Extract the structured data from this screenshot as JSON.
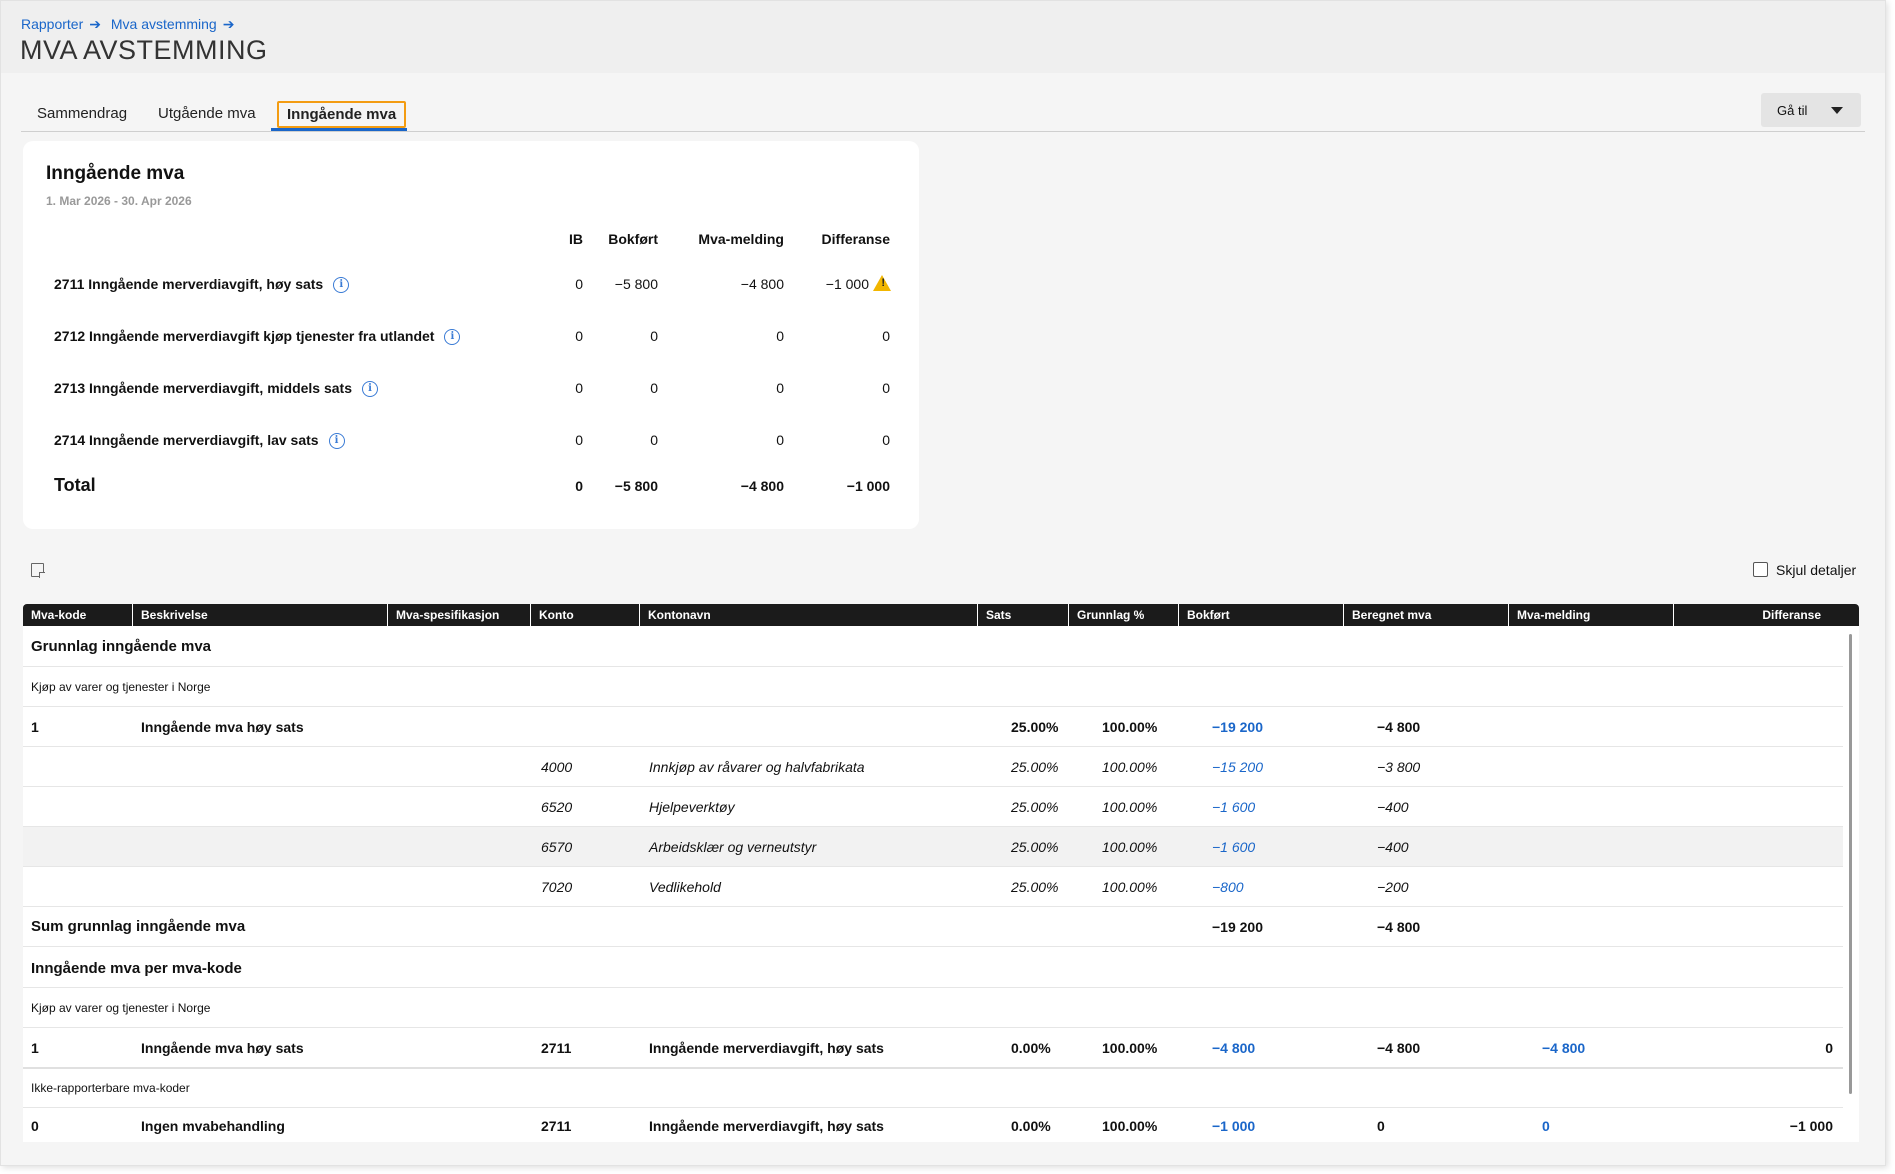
{
  "breadcrumb": [
    "Rapporter",
    "Mva avstemming"
  ],
  "page_title": "MVA AVSTEMMING",
  "tabs": [
    "Sammendrag",
    "Utgående mva",
    "Inngående mva"
  ],
  "active_tab": "Inngående mva",
  "goto_label": "Gå til",
  "summary": {
    "title": "Inngående mva",
    "period": "1. Mar 2026 - 30. Apr 2026",
    "headers": [
      "IB",
      "Bokført",
      "Mva-melding",
      "Differanse"
    ],
    "rows": [
      {
        "label": "2711 Inngående merverdiavgift, høy sats",
        "ib": "0",
        "bokfort": "−5 800",
        "mva_melding": "−4 800",
        "differanse": "−1 000",
        "warning": true
      },
      {
        "label": "2712 Inngående merverdiavgift kjøp tjenester fra utlandet",
        "ib": "0",
        "bokfort": "0",
        "mva_melding": "0",
        "differanse": "0"
      },
      {
        "label": "2713 Inngående merverdiavgift, middels sats",
        "ib": "0",
        "bokfort": "0",
        "mva_melding": "0",
        "differanse": "0"
      },
      {
        "label": "2714 Inngående merverdiavgift, lav sats",
        "ib": "0",
        "bokfort": "0",
        "mva_melding": "0",
        "differanse": "0"
      }
    ],
    "total": {
      "label": "Total",
      "ib": "0",
      "bokfort": "−5 800",
      "mva_melding": "−4 800",
      "differanse": "−1 000"
    }
  },
  "hide_details_label": "Skjul detaljer",
  "grid": {
    "headers": [
      "Mva-kode",
      "Beskrivelse",
      "Mva-spesifikasjon",
      "Konto",
      "Kontonavn",
      "Sats",
      "Grunnlag %",
      "Bokført",
      "Beregnet mva",
      "Mva-melding",
      "Differanse"
    ],
    "section1_title": "Grunnlag inngående mva",
    "group1_title": "Kjøp av varer og tjenester i Norge",
    "code_row": {
      "kode": "1",
      "beskrivelse": "Inngående mva høy sats",
      "sats": "25.00%",
      "grunnlag": "100.00%",
      "bokfort": "−19 200",
      "beregnet": "−4 800"
    },
    "detail_rows": [
      {
        "konto": "4000",
        "kontonavn": "Innkjøp av råvarer og halvfabrikata",
        "sats": "25.00%",
        "grunnlag": "100.00%",
        "bokfort": "−15 200",
        "beregnet": "−3 800"
      },
      {
        "konto": "6520",
        "kontonavn": "Hjelpeverktøy",
        "sats": "25.00%",
        "grunnlag": "100.00%",
        "bokfort": "−1 600",
        "beregnet": "−400"
      },
      {
        "konto": "6570",
        "kontonavn": "Arbeidsklær og verneutstyr",
        "sats": "25.00%",
        "grunnlag": "100.00%",
        "bokfort": "−1 600",
        "beregnet": "−400"
      },
      {
        "konto": "7020",
        "kontonavn": "Vedlikehold",
        "sats": "25.00%",
        "grunnlag": "100.00%",
        "bokfort": "−800",
        "beregnet": "−200"
      }
    ],
    "sum_row": {
      "label": "Sum grunnlag inngående mva",
      "bokfort": "−19 200",
      "beregnet": "−4 800"
    },
    "section2_title": "Inngående mva per mva-kode",
    "group2_title": "Kjøp av varer og tjenester i Norge",
    "code_row2": {
      "kode": "1",
      "beskrivelse": "Inngående mva høy sats",
      "konto": "2711",
      "kontonavn": "Inngående merverdiavgift, høy sats",
      "sats": "0.00%",
      "grunnlag": "100.00%",
      "bokfort": "−4 800",
      "beregnet": "−4 800",
      "mva_melding": "−4 800",
      "differanse": "0"
    },
    "group3_title": "Ikke-rapporterbare mva-koder",
    "code_row3": {
      "kode": "0",
      "beskrivelse": "Ingen mvabehandling",
      "konto": "2711",
      "kontonavn": "Inngående merverdiavgift, høy sats",
      "sats": "0.00%",
      "grunnlag": "100.00%",
      "bokfort": "−1 000",
      "beregnet": "0",
      "mva_melding": "0",
      "differanse": "−1 000"
    }
  },
  "colors": {
    "accent": "#1a66c9",
    "highlight": "#f39c12",
    "warning": "#f2b600",
    "header_bg": "#1b1b1b"
  }
}
